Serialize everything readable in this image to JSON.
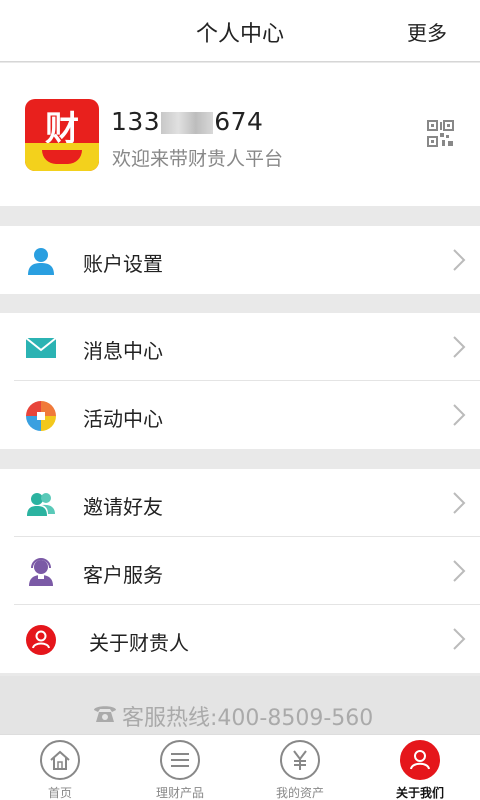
{
  "header": {
    "title": "个人中心",
    "more": "更多"
  },
  "profile": {
    "logo_char": "财",
    "phone_prefix": "133",
    "phone_suffix": "674",
    "welcome": "欢迎来带财贵人平台"
  },
  "groups": [
    {
      "items": [
        {
          "label": "账户设置",
          "icon": "user-icon"
        }
      ]
    },
    {
      "items": [
        {
          "label": "消息中心",
          "icon": "envelope-icon"
        },
        {
          "label": "活动中心",
          "icon": "pinwheel-icon"
        }
      ]
    },
    {
      "items": [
        {
          "label": "邀请好友",
          "icon": "people-icon"
        },
        {
          "label": "客户服务",
          "icon": "customer-service-icon"
        },
        {
          "label": "关于财贵人",
          "icon": "about-user-icon"
        }
      ]
    }
  ],
  "hotline": "客服热线:400-8509-560",
  "tabs": [
    {
      "label": "首页",
      "icon": "home-icon",
      "active": false
    },
    {
      "label": "理财产品",
      "icon": "list-icon",
      "active": false
    },
    {
      "label": "我的资产",
      "icon": "yuan-icon",
      "active": false
    },
    {
      "label": "关于我们",
      "icon": "user-icon",
      "active": true
    }
  ],
  "colors": {
    "accent": "#e5161b",
    "logo_yellow": "#f3d11c",
    "icon_blue": "#2a9fe0",
    "icon_teal": "#2bb3b3",
    "icon_purple": "#7b5aa6"
  }
}
